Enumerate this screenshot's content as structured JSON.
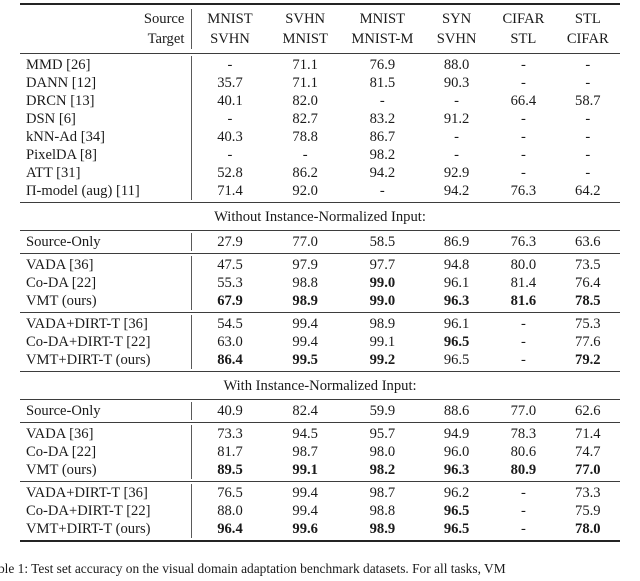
{
  "table": {
    "header": {
      "source_label": "Source",
      "target_label": "Target",
      "columns": [
        {
          "source": "MNIST",
          "target": "SVHN"
        },
        {
          "source": "SVHN",
          "target": "MNIST"
        },
        {
          "source": "MNIST",
          "target": "MNIST-M"
        },
        {
          "source": "SYN",
          "target": "SVHN"
        },
        {
          "source": "CIFAR",
          "target": "STL"
        },
        {
          "source": "STL",
          "target": "CIFAR"
        }
      ]
    },
    "sections": [
      {
        "label": null,
        "groups": [
          {
            "rows": [
              {
                "method": "MMD [26]",
                "values": [
                  "-",
                  "71.1",
                  "76.9",
                  "88.0",
                  "-",
                  "-"
                ],
                "bold": [
                  false,
                  false,
                  false,
                  false,
                  false,
                  false
                ]
              },
              {
                "method": "DANN [12]",
                "values": [
                  "35.7",
                  "71.1",
                  "81.5",
                  "90.3",
                  "-",
                  "-"
                ],
                "bold": [
                  false,
                  false,
                  false,
                  false,
                  false,
                  false
                ]
              },
              {
                "method": "DRCN [13]",
                "values": [
                  "40.1",
                  "82.0",
                  "-",
                  "-",
                  "66.4",
                  "58.7"
                ],
                "bold": [
                  false,
                  false,
                  false,
                  false,
                  false,
                  false
                ]
              },
              {
                "method": "DSN [6]",
                "values": [
                  "-",
                  "82.7",
                  "83.2",
                  "91.2",
                  "-",
                  "-"
                ],
                "bold": [
                  false,
                  false,
                  false,
                  false,
                  false,
                  false
                ]
              },
              {
                "method": "kNN-Ad [34]",
                "values": [
                  "40.3",
                  "78.8",
                  "86.7",
                  "-",
                  "-",
                  "-"
                ],
                "bold": [
                  false,
                  false,
                  false,
                  false,
                  false,
                  false
                ]
              },
              {
                "method": "PixelDA [8]",
                "values": [
                  "-",
                  "-",
                  "98.2",
                  "-",
                  "-",
                  "-"
                ],
                "bold": [
                  false,
                  false,
                  false,
                  false,
                  false,
                  false
                ]
              },
              {
                "method": "ATT [31]",
                "values": [
                  "52.8",
                  "86.2",
                  "94.2",
                  "92.9",
                  "-",
                  "-"
                ],
                "bold": [
                  false,
                  false,
                  false,
                  false,
                  false,
                  false
                ]
              },
              {
                "method": "Π-model (aug) [11]",
                "values": [
                  "71.4",
                  "92.0",
                  "-",
                  "94.2",
                  "76.3",
                  "64.2"
                ],
                "bold": [
                  false,
                  false,
                  false,
                  false,
                  false,
                  false
                ]
              }
            ]
          }
        ]
      },
      {
        "label": "Without Instance-Normalized Input:",
        "groups": [
          {
            "rows": [
              {
                "method": "Source-Only",
                "values": [
                  "27.9",
                  "77.0",
                  "58.5",
                  "86.9",
                  "76.3",
                  "63.6"
                ],
                "bold": [
                  false,
                  false,
                  false,
                  false,
                  false,
                  false
                ]
              }
            ]
          },
          {
            "rows": [
              {
                "method": "VADA [36]",
                "values": [
                  "47.5",
                  "97.9",
                  "97.7",
                  "94.8",
                  "80.0",
                  "73.5"
                ],
                "bold": [
                  false,
                  false,
                  false,
                  false,
                  false,
                  false
                ]
              },
              {
                "method": "Co-DA [22]",
                "values": [
                  "55.3",
                  "98.8",
                  "99.0",
                  "96.1",
                  "81.4",
                  "76.4"
                ],
                "bold": [
                  false,
                  false,
                  true,
                  false,
                  false,
                  false
                ]
              },
              {
                "method": "VMT (ours)",
                "values": [
                  "67.9",
                  "98.9",
                  "99.0",
                  "96.3",
                  "81.6",
                  "78.5"
                ],
                "bold": [
                  true,
                  true,
                  true,
                  true,
                  true,
                  true
                ]
              }
            ]
          },
          {
            "rows": [
              {
                "method": "VADA+DIRT-T [36]",
                "values": [
                  "54.5",
                  "99.4",
                  "98.9",
                  "96.1",
                  "-",
                  "75.3"
                ],
                "bold": [
                  false,
                  false,
                  false,
                  false,
                  false,
                  false
                ]
              },
              {
                "method": "Co-DA+DIRT-T [22]",
                "values": [
                  "63.0",
                  "99.4",
                  "99.1",
                  "96.5",
                  "-",
                  "77.6"
                ],
                "bold": [
                  false,
                  false,
                  false,
                  true,
                  false,
                  false
                ]
              },
              {
                "method": "VMT+DIRT-T (ours)",
                "values": [
                  "86.4",
                  "99.5",
                  "99.2",
                  "96.5",
                  "-",
                  "79.2"
                ],
                "bold": [
                  true,
                  true,
                  true,
                  false,
                  false,
                  true
                ]
              }
            ]
          }
        ]
      },
      {
        "label": "With Instance-Normalized Input:",
        "groups": [
          {
            "rows": [
              {
                "method": "Source-Only",
                "values": [
                  "40.9",
                  "82.4",
                  "59.9",
                  "88.6",
                  "77.0",
                  "62.6"
                ],
                "bold": [
                  false,
                  false,
                  false,
                  false,
                  false,
                  false
                ]
              }
            ]
          },
          {
            "rows": [
              {
                "method": "VADA [36]",
                "values": [
                  "73.3",
                  "94.5",
                  "95.7",
                  "94.9",
                  "78.3",
                  "71.4"
                ],
                "bold": [
                  false,
                  false,
                  false,
                  false,
                  false,
                  false
                ]
              },
              {
                "method": "Co-DA [22]",
                "values": [
                  "81.7",
                  "98.7",
                  "98.0",
                  "96.0",
                  "80.6",
                  "74.7"
                ],
                "bold": [
                  false,
                  false,
                  false,
                  false,
                  false,
                  false
                ]
              },
              {
                "method": "VMT (ours)",
                "values": [
                  "89.5",
                  "99.1",
                  "98.2",
                  "96.3",
                  "80.9",
                  "77.0"
                ],
                "bold": [
                  true,
                  true,
                  true,
                  true,
                  true,
                  true
                ]
              }
            ]
          },
          {
            "rows": [
              {
                "method": "VADA+DIRT-T [36]",
                "values": [
                  "76.5",
                  "99.4",
                  "98.7",
                  "96.2",
                  "-",
                  "73.3"
                ],
                "bold": [
                  false,
                  false,
                  false,
                  false,
                  false,
                  false
                ]
              },
              {
                "method": "Co-DA+DIRT-T [22]",
                "values": [
                  "88.0",
                  "99.4",
                  "98.8",
                  "96.5",
                  "-",
                  "75.9"
                ],
                "bold": [
                  false,
                  false,
                  false,
                  true,
                  false,
                  false
                ]
              },
              {
                "method": "VMT+DIRT-T (ours)",
                "values": [
                  "96.4",
                  "99.6",
                  "98.9",
                  "96.5",
                  "-",
                  "78.0"
                ],
                "bold": [
                  true,
                  true,
                  true,
                  true,
                  false,
                  true
                ]
              }
            ]
          }
        ]
      }
    ]
  },
  "caption": "able 1: Test set accuracy on the visual domain adaptation benchmark datasets. For all tasks, VM"
}
